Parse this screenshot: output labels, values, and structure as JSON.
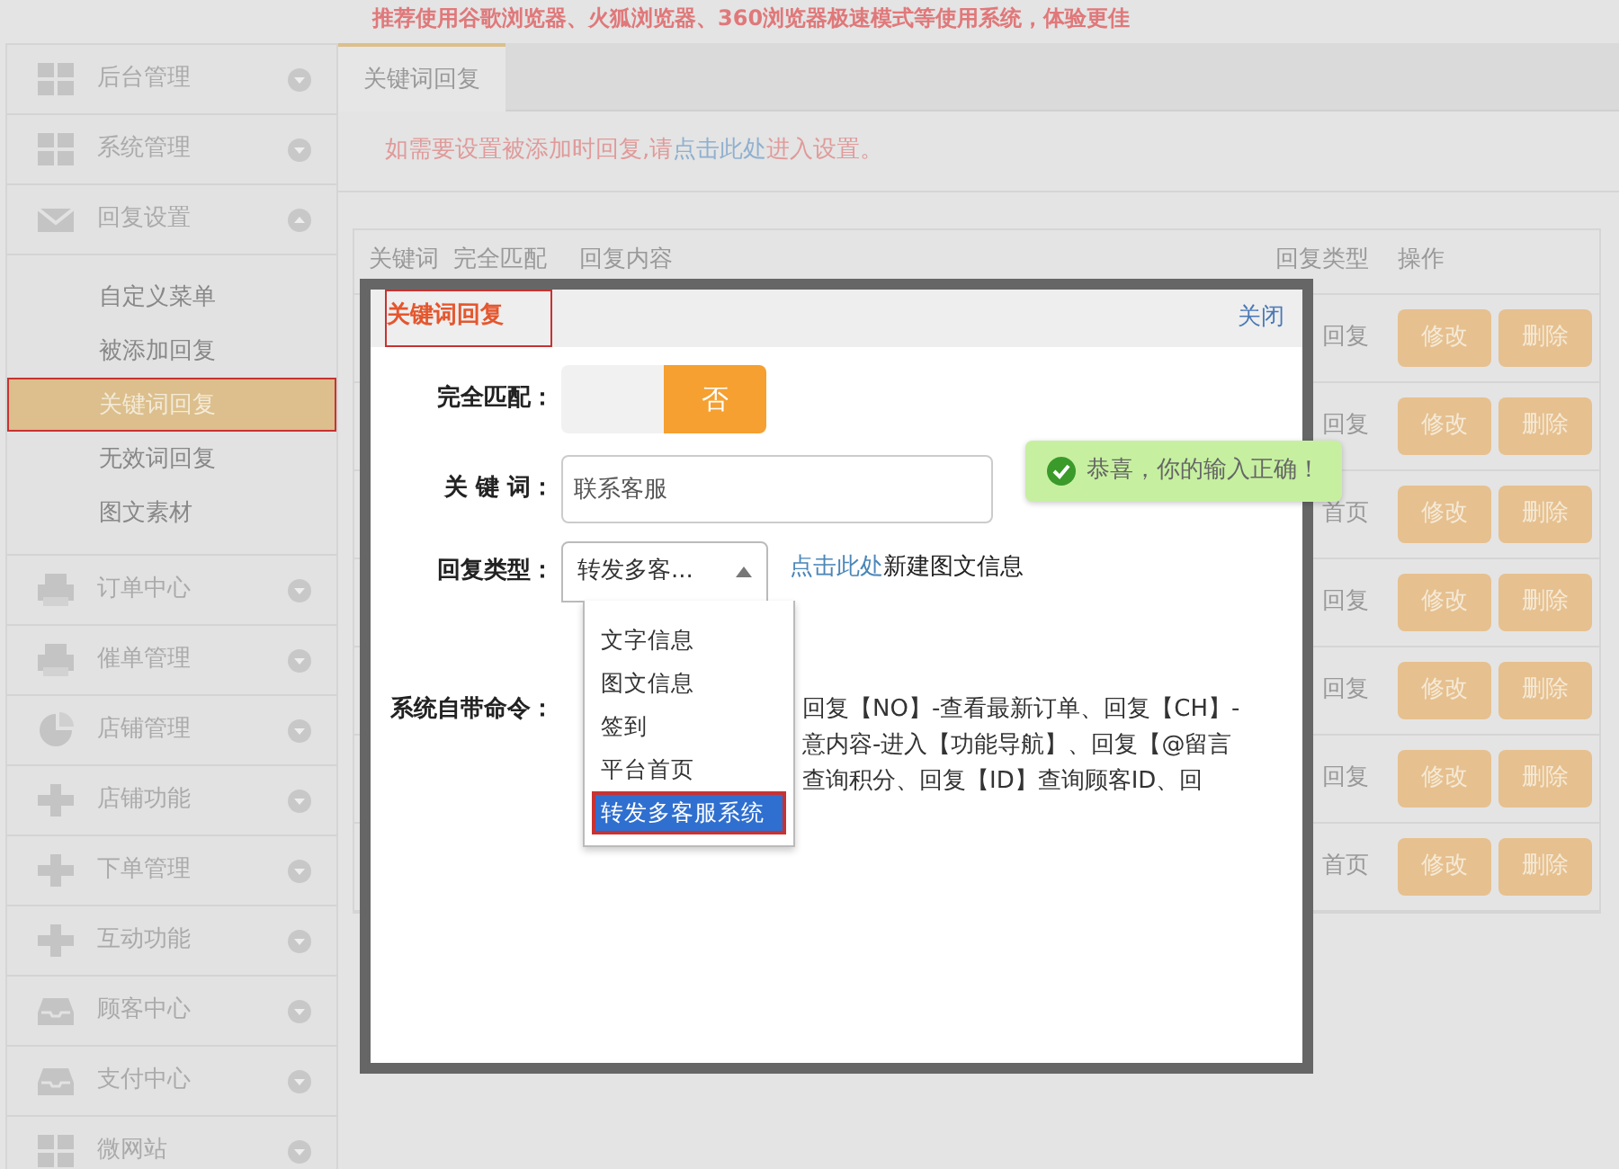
{
  "banner": "推荐使用谷歌浏览器、火狐浏览器、360浏览器极速模式等使用系统，体验更佳",
  "sidebar": {
    "items": [
      {
        "label": "后台管理",
        "expanded": false
      },
      {
        "label": "系统管理",
        "expanded": false
      },
      {
        "label": "回复设置",
        "expanded": true,
        "children": [
          {
            "label": "自定义菜单",
            "selected": false,
            "highlighted": false
          },
          {
            "label": "被添加回复",
            "selected": false,
            "highlighted": false
          },
          {
            "label": "关键词回复",
            "selected": true,
            "highlighted": true
          },
          {
            "label": "无效词回复",
            "selected": false,
            "highlighted": false
          },
          {
            "label": "图文素材",
            "selected": false,
            "highlighted": false
          }
        ]
      },
      {
        "label": "订单中心",
        "expanded": false
      },
      {
        "label": "催单管理",
        "expanded": false
      },
      {
        "label": "店铺管理",
        "expanded": false
      },
      {
        "label": "店铺功能",
        "expanded": false
      },
      {
        "label": "下单管理",
        "expanded": false
      },
      {
        "label": "互动功能",
        "expanded": false
      },
      {
        "label": "顾客中心",
        "expanded": false
      },
      {
        "label": "支付中心",
        "expanded": false
      },
      {
        "label": "微网站",
        "expanded": false
      }
    ]
  },
  "tabs": [
    {
      "label": "关键词回复",
      "selected": true
    }
  ],
  "notice": {
    "before": "如需要设置被添加时回复,请",
    "link": "点击此处",
    "after": "进入设置。"
  },
  "table": {
    "columns": [
      "关键词",
      "完全匹配",
      "回复内容",
      "回复类型",
      "操作"
    ],
    "rows": [
      {
        "type": "回复",
        "actions": [
          "修改",
          "删除"
        ]
      },
      {
        "type": "回复",
        "actions": [
          "修改",
          "删除"
        ]
      },
      {
        "type": "首页",
        "actions": [
          "修改",
          "删除"
        ]
      },
      {
        "type": "回复",
        "actions": [
          "修改",
          "删除"
        ]
      },
      {
        "type": "回复",
        "actions": [
          "修改",
          "删除"
        ]
      },
      {
        "type": "回复",
        "actions": [
          "修改",
          "删除"
        ]
      },
      {
        "type": "首页",
        "actions": [
          "修改",
          "删除"
        ]
      }
    ]
  },
  "dialog": {
    "title": "关键词回复",
    "title_highlighted": true,
    "close": "关闭",
    "exact_match": {
      "label": "完全匹配：",
      "value": "否",
      "on": false
    },
    "keyword": {
      "label": "关 键 词：",
      "value": "联系客服"
    },
    "tooltip": "恭喜，你的输入正确！",
    "reply_type": {
      "label": "回复类型：",
      "value": "转发多客...",
      "expanded": true,
      "options": [
        {
          "label": "文字信息",
          "selected": false,
          "highlighted": false
        },
        {
          "label": "图文信息",
          "selected": false,
          "highlighted": false
        },
        {
          "label": "签到",
          "selected": false,
          "highlighted": false
        },
        {
          "label": "平台首页",
          "selected": false,
          "highlighted": false
        },
        {
          "label": "转发多客服系统",
          "selected": true,
          "highlighted": true
        }
      ]
    },
    "new_link": "点击此处",
    "new_text": "新建图文信息",
    "commands": {
      "label": "系统自带命令：",
      "lines": [
        "回复【NO】-查看最新订单、回复【CH】-",
        "意内容-进入【功能导航】、回复【@留言",
        "查询积分、回复【ID】查询顾客ID、回"
      ]
    }
  }
}
